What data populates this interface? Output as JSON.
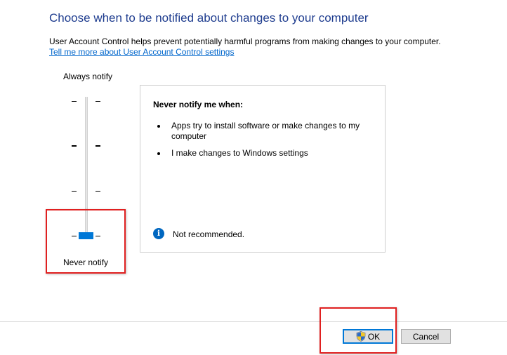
{
  "header": {
    "title": "Choose when to be notified about changes to your computer",
    "description": "User Account Control helps prevent potentially harmful programs from making changes to your computer.",
    "learn_more_link": "Tell me more about User Account Control settings"
  },
  "slider": {
    "top_label": "Always notify",
    "bottom_label": "Never notify",
    "level_count": 4,
    "selected_level": 1
  },
  "info_panel": {
    "title": "Never notify me when:",
    "bullets": [
      "Apps try to install software or make changes to my computer",
      "I make changes to Windows settings"
    ],
    "recommendation": "Not recommended.",
    "icon": "info-icon"
  },
  "buttons": {
    "ok_label": "OK",
    "ok_icon": "uac-shield-icon",
    "cancel_label": "Cancel"
  },
  "colors": {
    "heading": "#1f3d8f",
    "link": "#0066cc",
    "slider_thumb": "#0078d7",
    "highlight": "#e02020"
  }
}
